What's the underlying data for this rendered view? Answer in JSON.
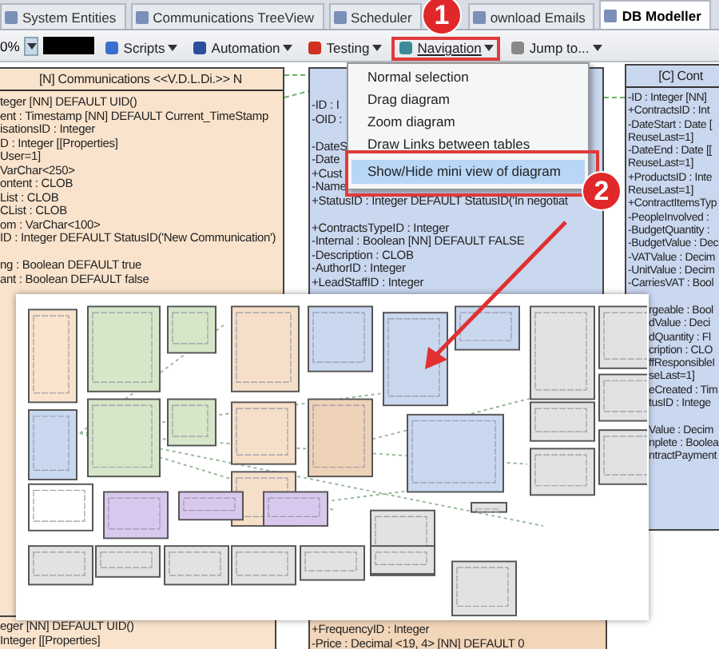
{
  "tabs": [
    {
      "label": "System Entities",
      "selected": false
    },
    {
      "label": "Communications TreeView",
      "selected": false
    },
    {
      "label": "Scheduler",
      "selected": false
    },
    {
      "label": "ownload Emails",
      "selected": false
    },
    {
      "label": "DB Modeller",
      "selected": true
    }
  ],
  "toolbar": {
    "zoom": "0%",
    "items": [
      {
        "label": "Scripts",
        "highlighted": false
      },
      {
        "label": "Automation",
        "highlighted": false
      },
      {
        "label": "Testing",
        "highlighted": false
      },
      {
        "label": "Navigation",
        "highlighted": true
      },
      {
        "label": "Jump to...",
        "highlighted": false
      }
    ]
  },
  "entities": [
    {
      "header": "[N] Communications <<V.D.L.Di.>> N",
      "color": "#f9e3cc",
      "sections": [
        [
          "teger [NN] DEFAULT UID()",
          "ent : Timestamp [NN] DEFAULT Current_TimeStamp",
          "isationsID : Integer",
          "D : Integer [[Properties]",
          "User=1]",
          "VarChar<250>",
          "ontent : CLOB",
          "List : CLOB",
          "CList : CLOB",
          "om : VarChar<100>",
          "ID : Integer DEFAULT StatusID('New Communication')"
        ],
        [
          "ng : Boolean DEFAULT true",
          "ant : Boolean DEFAULT false"
        ]
      ]
    },
    {
      "color": "#c9d7ef",
      "sections": [
        [
          "-ID : I",
          "-OID :"
        ],
        [
          "-DateS",
          "-Date",
          "+Cust",
          "-Name",
          "+StatusID : Integer DEFAULT StatusID('In negotiat"
        ],
        [
          "+ContractsTypeID : Integer",
          "-Internal : Boolean [NN] DEFAULT FALSE",
          "-Description : CLOB",
          "-AuthorID : Integer",
          "+LeadStaffID : Integer"
        ]
      ]
    },
    {
      "header": "[C] Cont",
      "color": "#c9d7ef",
      "sections": [
        [
          "-ID : Integer [NN]",
          "+ContractsID : Int",
          "-DateStart : Date [",
          "ReuseLast=1]",
          "-DateEnd : Date [[",
          "ReuseLast=1]",
          "+ProductsID : Inte",
          "ReuseLast=1]",
          "+ContractItemsTyp",
          "-PeopleInvolved :",
          "-BudgetQuantity :",
          "-BudgetValue : Dec",
          "-VATValue : Decim",
          "-UnitValue : Decim",
          "-CarriesVAT : Bool"
        ]
      ],
      "clipped_sections": [
        [
          "rgeable : Bool",
          "dValue : Deci",
          "dQuantity : Fl",
          "cription : CLO",
          "ffResponsibleI",
          "seLast=1]",
          "eCreated : Tim",
          "tusID : Intege"
        ],
        [
          "Value : Decim",
          "nplete : Boolea",
          "ntractPayment"
        ]
      ]
    },
    {
      "color": "#f9e3cc",
      "sections": [
        [
          "eger [NN] DEFAULT UID()",
          "Integer [[Properties]"
        ]
      ]
    },
    {
      "color": "#f2d6ba",
      "sections": [
        [
          "+FrequencyID : Integer",
          "-Price : Decimal <19, 4> [NN] DEFAULT 0"
        ]
      ]
    }
  ],
  "menu": {
    "items": [
      {
        "label": "Normal selection",
        "selected": false
      },
      {
        "label": "Drag diagram",
        "selected": false
      },
      {
        "label": "Zoom diagram",
        "selected": false
      },
      {
        "label": "Draw Links between tables",
        "selected": false
      },
      {
        "label": "Show/Hide mini view of diagram",
        "selected": true
      }
    ]
  },
  "callouts": [
    "1",
    "2"
  ]
}
